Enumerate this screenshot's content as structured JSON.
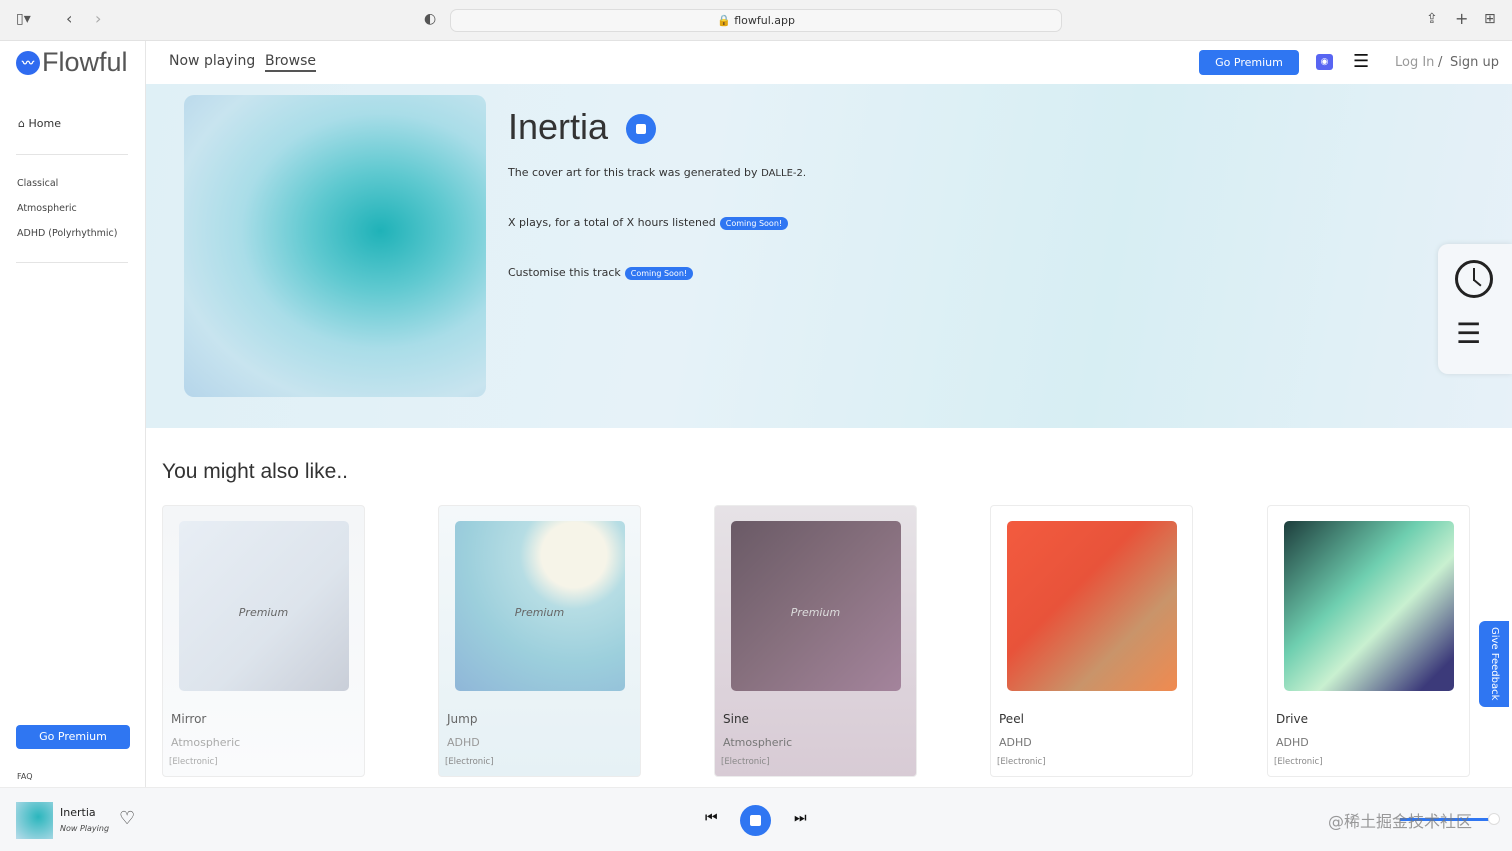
{
  "browser": {
    "url": "flowful.app"
  },
  "sidebar": {
    "logo": "Flowful",
    "home": "Home",
    "categories": [
      "Classical",
      "Atmospheric",
      "ADHD (Polyrhythmic)"
    ],
    "premium_button": "Go Premium",
    "faq": "FAQ"
  },
  "topnav": {
    "tabs": [
      "Now playing",
      "Browse"
    ],
    "active": "Browse",
    "premium_button": "Go Premium",
    "login": "Log In",
    "separator": "/",
    "signup": "Sign up"
  },
  "hero": {
    "title": "Inertia",
    "credit_text": "The cover art for this track was generated by",
    "credit_name": "DALLE-2.",
    "plays_text": "X plays, for a total of X hours listened",
    "customise_text": "Customise this track",
    "badge": "Coming Soon!"
  },
  "recommendations": {
    "title": "You might also like..",
    "cards": [
      {
        "name": "Mirror",
        "genre": "Atmospheric",
        "tag": "[Electronic]",
        "premium": "Premium"
      },
      {
        "name": "Jump",
        "genre": "ADHD",
        "tag": "[Electronic]",
        "premium": "Premium"
      },
      {
        "name": "Sine",
        "genre": "Atmospheric",
        "tag": "[Electronic]",
        "premium": "Premium"
      },
      {
        "name": "Peel",
        "genre": "ADHD",
        "tag": "[Electronic]",
        "premium": ""
      },
      {
        "name": "Drive",
        "genre": "ADHD",
        "tag": "[Electronic]",
        "premium": ""
      }
    ]
  },
  "feedback": "Give Feedback",
  "player": {
    "title": "Inertia",
    "subtitle": "Now Playing",
    "volume": 1.0
  },
  "watermark": "@稀土掘金技术社区",
  "colors": {
    "accent": "#2f76f2"
  }
}
